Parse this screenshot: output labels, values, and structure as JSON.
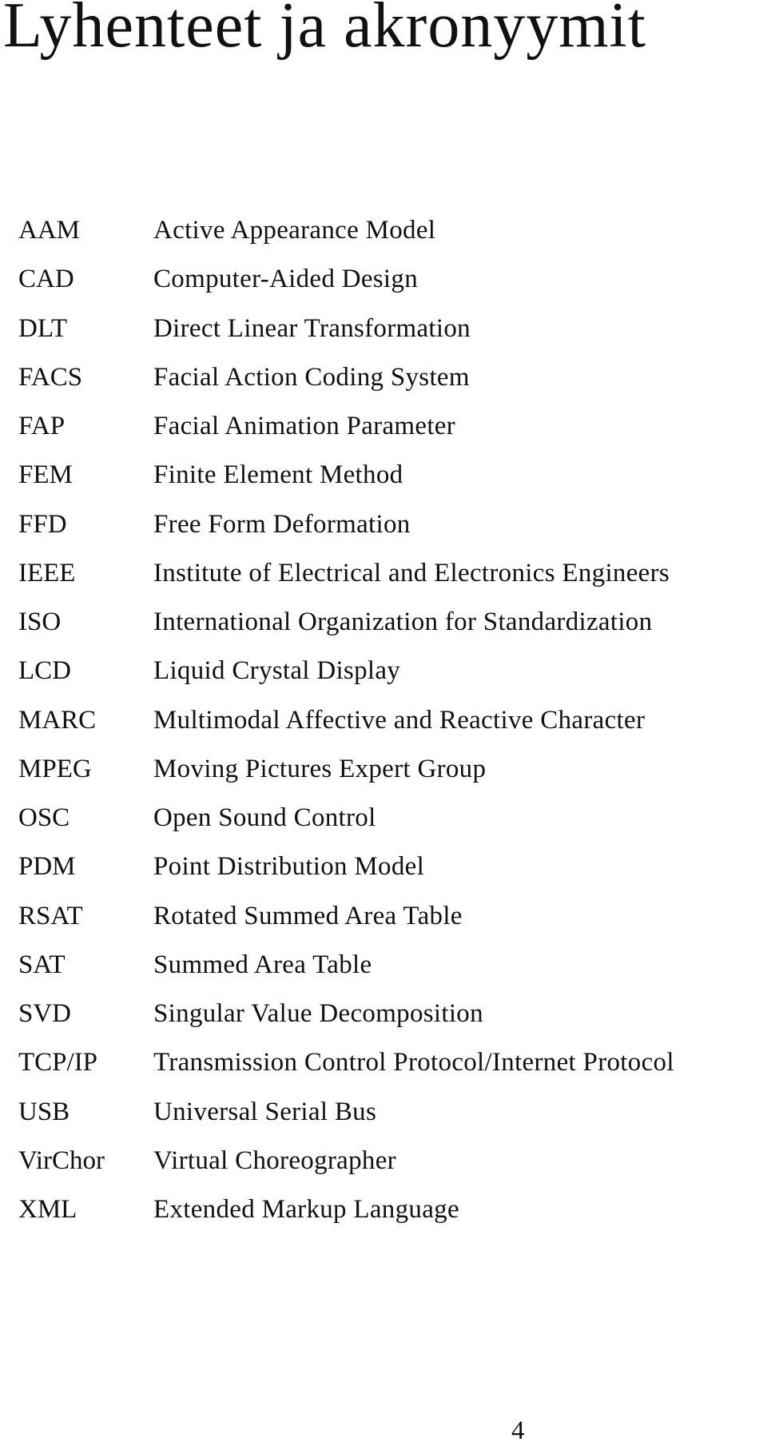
{
  "title": "Lyhenteet ja akronyymit",
  "entries": [
    {
      "abbr": "AAM",
      "full": "Active Appearance Model"
    },
    {
      "abbr": "CAD",
      "full": "Computer-Aided Design"
    },
    {
      "abbr": "DLT",
      "full": "Direct Linear Transformation"
    },
    {
      "abbr": "FACS",
      "full": "Facial Action Coding System"
    },
    {
      "abbr": "FAP",
      "full": "Facial Animation Parameter"
    },
    {
      "abbr": "FEM",
      "full": "Finite Element Method"
    },
    {
      "abbr": "FFD",
      "full": "Free Form Deformation"
    },
    {
      "abbr": "IEEE",
      "full": "Institute of Electrical and Electronics Engineers"
    },
    {
      "abbr": "ISO",
      "full": "International Organization for Standardization"
    },
    {
      "abbr": "LCD",
      "full": "Liquid Crystal Display"
    },
    {
      "abbr": "MARC",
      "full": "Multimodal Affective and Reactive Character"
    },
    {
      "abbr": "MPEG",
      "full": "Moving Pictures Expert Group"
    },
    {
      "abbr": "OSC",
      "full": "Open Sound Control"
    },
    {
      "abbr": "PDM",
      "full": "Point Distribution Model"
    },
    {
      "abbr": "RSAT",
      "full": "Rotated Summed Area Table"
    },
    {
      "abbr": "SAT",
      "full": "Summed Area Table"
    },
    {
      "abbr": "SVD",
      "full": "Singular Value Decomposition"
    },
    {
      "abbr": "TCP/IP",
      "full": "Transmission Control Protocol/Internet Protocol"
    },
    {
      "abbr": "USB",
      "full": "Universal Serial Bus"
    },
    {
      "abbr": "VirChor",
      "full": "Virtual Choreographer"
    },
    {
      "abbr": "XML",
      "full": "Extended Markup Language"
    }
  ],
  "page_number": "4"
}
